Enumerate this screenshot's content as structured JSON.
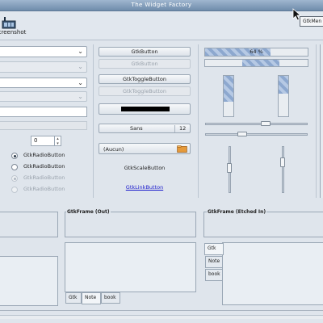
{
  "window": {
    "title": "The Widget Factory"
  },
  "toolbar": {
    "screenshot_label": "screenshot"
  },
  "tooltip": {
    "text": "GtkMen"
  },
  "column1": {
    "spin_value": "0",
    "radios": [
      {
        "label": "GtkRadioButton",
        "checked": true,
        "enabled": true
      },
      {
        "label": "GtkRadioButton",
        "checked": false,
        "enabled": true
      },
      {
        "label": "GtkRadioButton",
        "checked": true,
        "enabled": false
      },
      {
        "label": "GtkRadioButton",
        "checked": false,
        "enabled": false
      }
    ]
  },
  "column2": {
    "button_label": "GtkButton",
    "button_disabled_label": "GtkButton",
    "toggle_label": "GtkToggleButton",
    "toggle_disabled_label": "GtkToggleButton",
    "color_swatch": "#000000",
    "font_name": "Sans",
    "font_size": "12",
    "file_chooser_label": "(Aucun)",
    "scale_button_label": "GtkScaleButton",
    "link_label": "GtkLinkButton"
  },
  "column3": {
    "progress_text": "64 %",
    "progress_fraction": 0.64,
    "hscale_values": [
      0.6,
      0.35
    ],
    "vscale_values": [
      0.45,
      0.3
    ]
  },
  "frames": {
    "out_label": "GtkFrame (Out)",
    "etched_label": "GtkFrame (Etched In)"
  },
  "notebooks": {
    "bottom_tabs": [
      "Gtk",
      "Note",
      "book"
    ],
    "side_tabs": [
      "Gtk",
      "Note",
      "book"
    ]
  },
  "colors": {
    "titlebar": "#7f9bba",
    "progress_stripe": "#8da8cf",
    "link": "#1a1acc"
  }
}
